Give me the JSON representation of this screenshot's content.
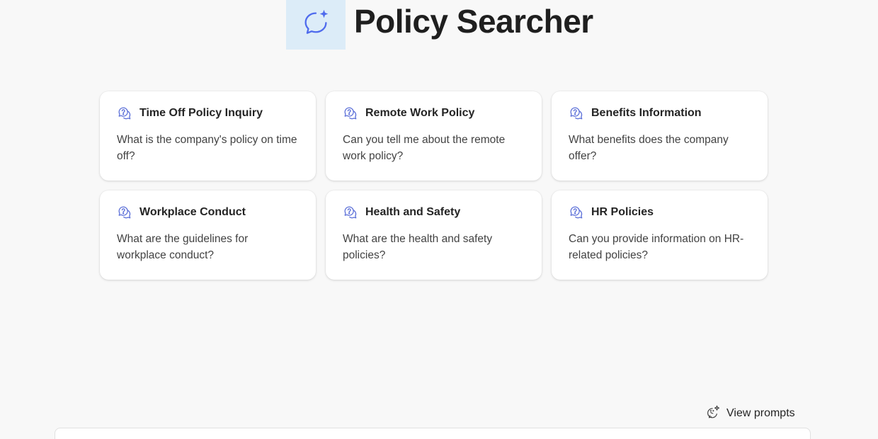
{
  "header": {
    "title": "Policy Searcher",
    "logo_icon": "chat-sparkle-icon",
    "logo_bg": "#dcecf8",
    "accent": "#4f6bed"
  },
  "cards": [
    {
      "title": "Time Off Policy Inquiry",
      "text": "What is the company's policy on time off?",
      "icon": "chat-question-icon"
    },
    {
      "title": "Remote Work Policy",
      "text": "Can you tell me about the remote work policy?",
      "icon": "chat-question-icon"
    },
    {
      "title": "Benefits Information",
      "text": "What benefits does the company offer?",
      "icon": "chat-question-icon"
    },
    {
      "title": "Workplace Conduct",
      "text": "What are the guidelines for workplace conduct?",
      "icon": "chat-question-icon"
    },
    {
      "title": "Health and Safety",
      "text": "What are the health and safety policies?",
      "icon": "chat-question-icon"
    },
    {
      "title": "HR Policies",
      "text": "Can you provide information on HR-related policies?",
      "icon": "chat-question-icon"
    }
  ],
  "footer": {
    "view_prompts_label": "View prompts",
    "view_prompts_icon": "prompt-sparkle-icon"
  }
}
